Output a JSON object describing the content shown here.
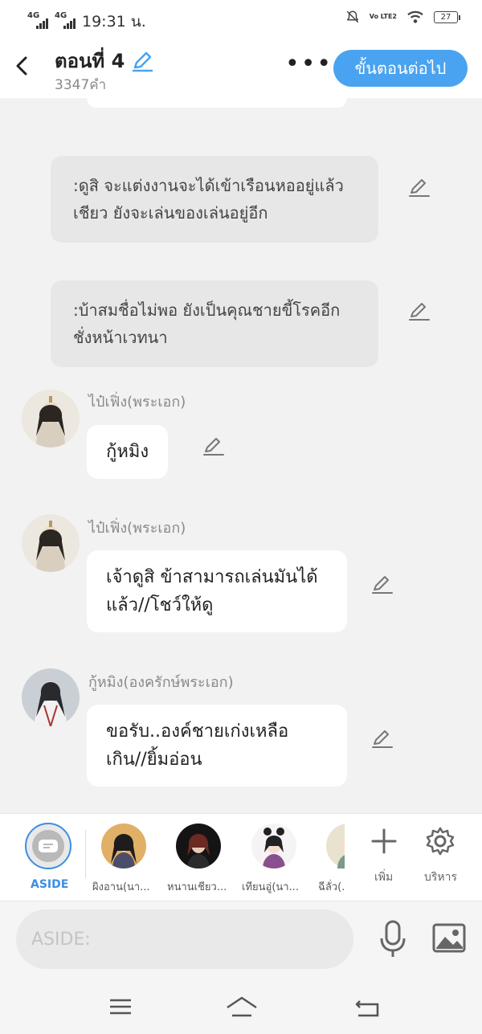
{
  "status": {
    "network1": "4G",
    "network2": "4G",
    "time": "19:31 น.",
    "volte": "Vo LTE2",
    "battery": "27"
  },
  "header": {
    "title": "ตอนที่ 4",
    "word_count": "3347คำ",
    "next_label": "ขั้นตอนต่อไป"
  },
  "messages": {
    "aside1": ":ดูสิ จะแต่งงานจะได้เข้าเรือนหออยู่แล้วเชียว ยังจะเล่นของเล่นอยู่อีก",
    "aside2": ":บ้าสมชื่อไม่พอ ยังเป็นคุณชายขี้โรคอีก ชั่งหน้าเวทนา",
    "msg1_name": "ไป๋เฟิ่ง(พระเอก)",
    "msg1_text": "กู้หมิง",
    "msg2_name": "ไป๋เฟิ่ง(พระเอก)",
    "msg2_text": "เจ้าดูสิ ข้าสามารถเล่นมันได้แล้ว//โชว์ให้ดู",
    "msg3_name": "กู้หมิง(องครักษ์พระเอก)",
    "msg3_text": "ขอรับ..องค์ชายเก่งเหลือเกิน//ยิ้มอ่อน"
  },
  "characters": {
    "aside_label": "ASIDE",
    "c1": "ผิงอาน(นา...",
    "c2": "หนานเชียว...",
    "c3": "เทียนอู่(นา...",
    "c4": "ฉีลั่ว(...",
    "add_label": "เพิ่ม",
    "manage_label": "บริหาร"
  },
  "input": {
    "placeholder": "ASIDE:"
  },
  "colors": {
    "accent": "#4aa3f0",
    "aside_blue": "#3d8ee0",
    "aside_bg": "#e7e7e7",
    "background": "#f2f2f2"
  }
}
